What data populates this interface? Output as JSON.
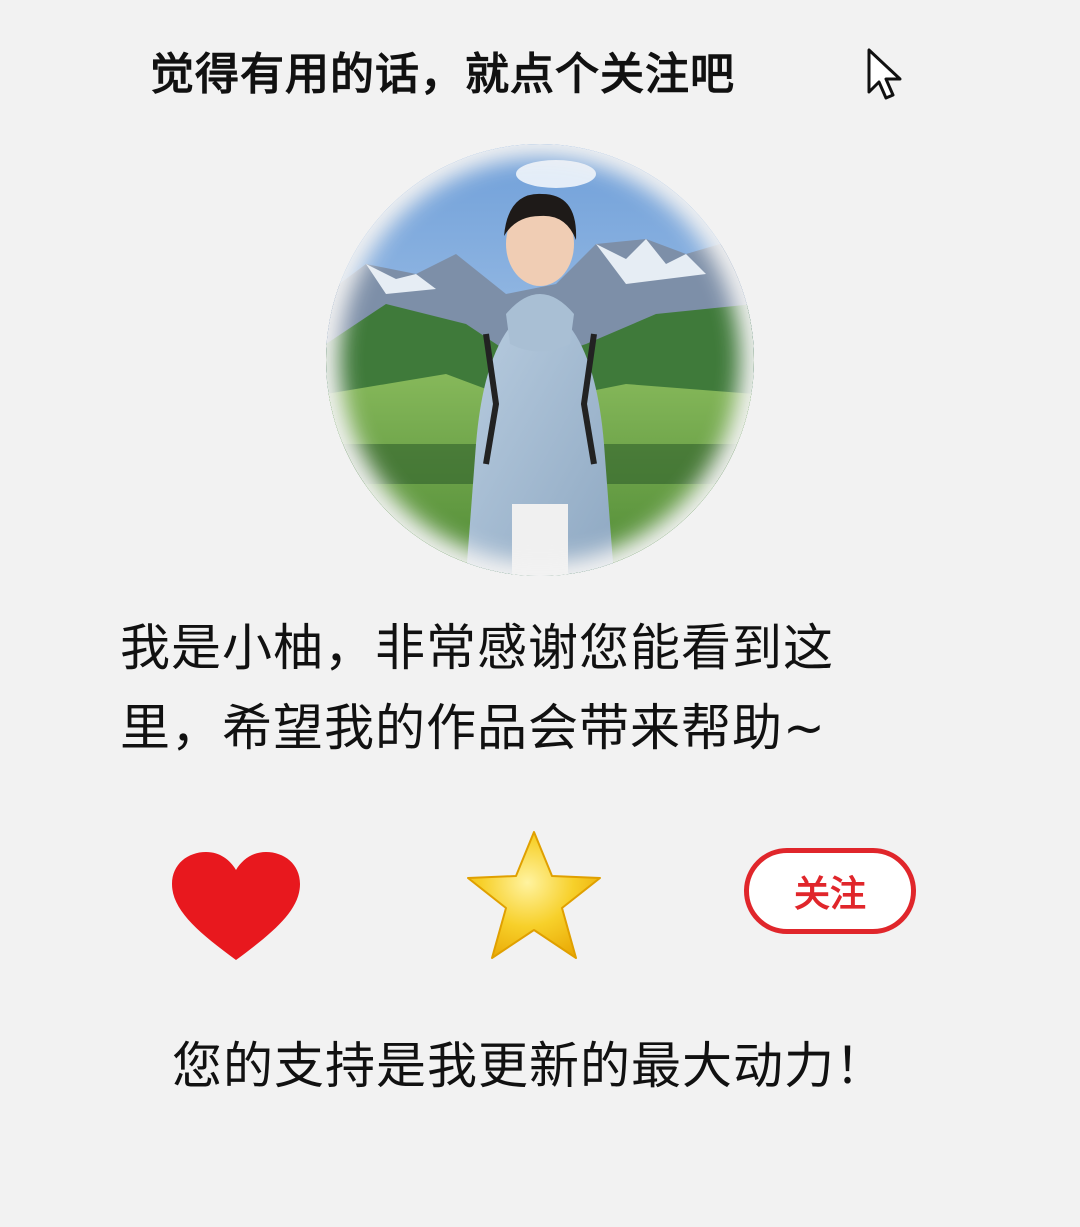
{
  "header": {
    "headline": "觉得有用的话，就点个关注吧"
  },
  "profile": {
    "intro_line1": "我是小柚，非常感谢您能看到这",
    "intro_line2": "里，希望我的作品会带来帮助~"
  },
  "actions": {
    "like_icon": "heart-icon",
    "favorite_icon": "star-icon",
    "follow_label": "关注",
    "accent_color": "#e0262b",
    "star_color": "#f5c518"
  },
  "footer": {
    "support_text": "您的支持是我更新的最大动力！"
  }
}
